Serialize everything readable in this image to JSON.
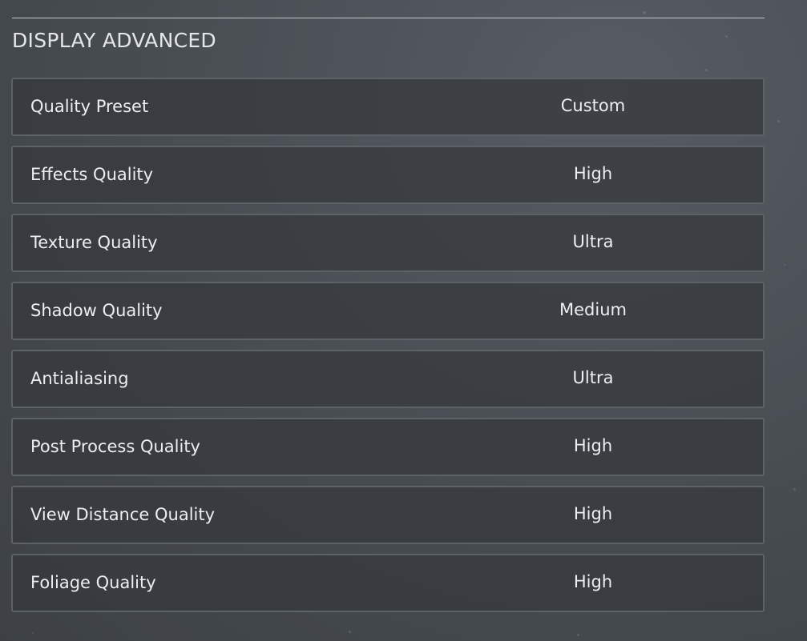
{
  "section": {
    "title": "DISPLAY ADVANCED"
  },
  "settings": [
    {
      "label": "Quality Preset",
      "value": "Custom"
    },
    {
      "label": "Effects Quality",
      "value": "High"
    },
    {
      "label": "Texture Quality",
      "value": "Ultra"
    },
    {
      "label": "Shadow Quality",
      "value": "Medium"
    },
    {
      "label": "Antialiasing",
      "value": "Ultra"
    },
    {
      "label": "Post Process Quality",
      "value": "High"
    },
    {
      "label": "View Distance Quality",
      "value": "High"
    },
    {
      "label": "Foliage Quality",
      "value": "High"
    }
  ]
}
